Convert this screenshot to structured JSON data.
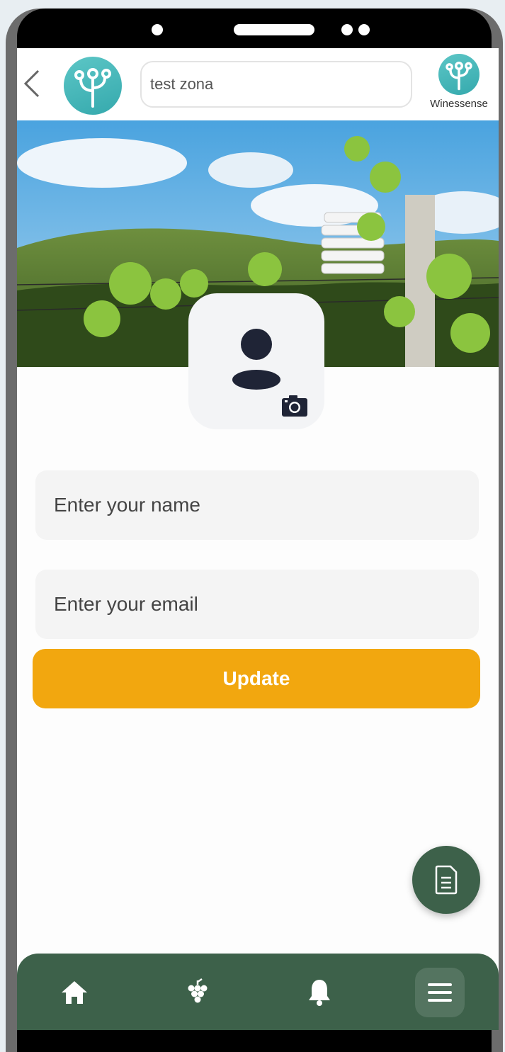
{
  "header": {
    "search_value": "test zona",
    "brand_name": "Winessense"
  },
  "form": {
    "name_placeholder": "Enter your name",
    "email_placeholder": "Enter your email",
    "update_label": "Update"
  },
  "colors": {
    "accent": "#f2a70f",
    "nav_green": "#3d614a",
    "logo_teal": "#41b3b5"
  },
  "bottom_nav": {
    "items": [
      "home-icon",
      "grapes-icon",
      "bell-icon",
      "menu-icon"
    ],
    "active": "menu-icon"
  }
}
